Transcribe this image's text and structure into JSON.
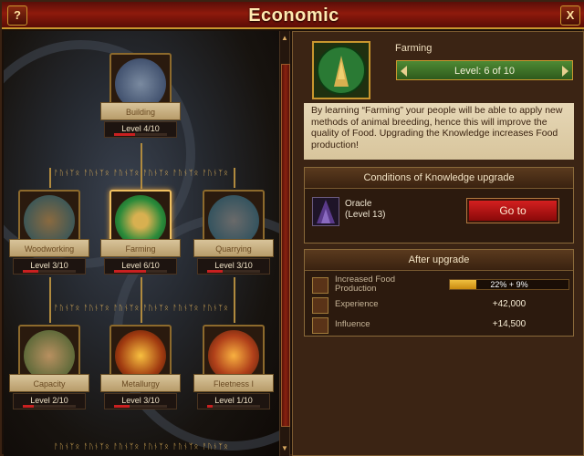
{
  "window": {
    "title": "Economic",
    "help_label": "?",
    "close_label": "X"
  },
  "runes": "ᚨᚢᚾᛉᛟ ᚨᚢᚾᛉᛟ ᚨᚢᚾᛉᛟ ᚨᚢᚾᛉᛟ ᚨᚢᚾᛉᛟ ᚨᚢᚾᛉᛟ",
  "skills": {
    "building": {
      "name": "Building",
      "level": "Level 4/10",
      "progress": 0.4
    },
    "woodworking": {
      "name": "Woodworking",
      "level": "Level 3/10",
      "progress": 0.3
    },
    "farming": {
      "name": "Farming",
      "level": "Level 6/10",
      "progress": 0.6
    },
    "quarrying": {
      "name": "Quarrying",
      "level": "Level 3/10",
      "progress": 0.3
    },
    "capacity": {
      "name": "Capacity",
      "level": "Level 2/10",
      "progress": 0.2
    },
    "metallurgy": {
      "name": "Metallurgy",
      "level": "Level 3/10",
      "progress": 0.3
    },
    "fleetness": {
      "name": "Fleetness I",
      "level": "Level 1/10",
      "progress": 0.1
    }
  },
  "detail": {
    "name": "Farming",
    "level": "Level: 6 of 10",
    "description": "By learning “Farming” your people will be able to apply new methods of animal breeding, hence this will improve the quality of Food. Upgrading the Knowledge increases Food production!"
  },
  "conditions": {
    "title": "Conditions of Knowledge upgrade",
    "building": "Oracle",
    "building_level": "(Level 13)",
    "goto_label": "Go to"
  },
  "after": {
    "title": "After upgrade",
    "rows": [
      {
        "label": "Increased Food Production",
        "value": "22% + 9%",
        "progress": 0.22
      },
      {
        "label": "Experience",
        "value": "+42,000"
      },
      {
        "label": "Influence",
        "value": "+14,500"
      }
    ]
  },
  "colors": {
    "accent_gold": "#c9962e",
    "level_banner": "#3e7428",
    "goto_red": "#c41a1a",
    "bar_red": "#c92020"
  }
}
